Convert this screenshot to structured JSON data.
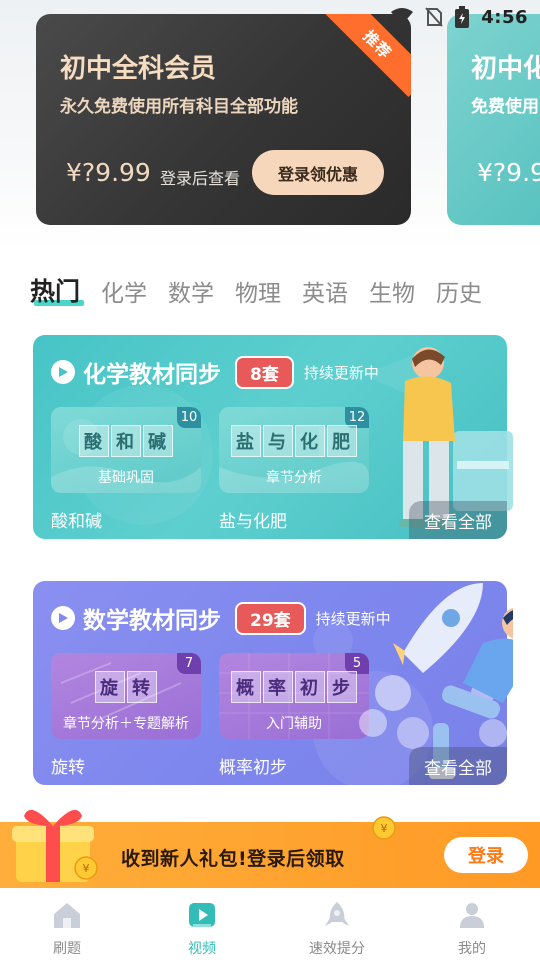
{
  "status_bar": {
    "time": "4:56",
    "icons": [
      "wifi-icon",
      "no-sim-icon",
      "battery-icon"
    ]
  },
  "member_cards": [
    {
      "title": "初中全科会员",
      "subtitle": "永久免费使用所有科目全部功能",
      "price": "¥?9.99",
      "price_note": "登录后查看",
      "button": "登录领优惠",
      "ribbon": "推荐"
    },
    {
      "title": "初中化",
      "subtitle": "免费使用",
      "price": "¥?9.9"
    }
  ],
  "subject_tabs": [
    "热门",
    "化学",
    "数学",
    "物理",
    "英语",
    "生物",
    "历史"
  ],
  "sections": [
    {
      "title": "化学教材同步",
      "count": "8套",
      "status": "持续更新中",
      "items": [
        {
          "cover_title": [
            "酸",
            "和",
            "碱"
          ],
          "cover_sub": "基础巩固",
          "count": "10",
          "label": "酸和碱"
        },
        {
          "cover_title": [
            "盐",
            "与",
            "化",
            "肥"
          ],
          "cover_sub": "章节分析",
          "count": "12",
          "label": "盐与化肥"
        }
      ],
      "see_all": "查看全部"
    },
    {
      "title": "数学教材同步",
      "count": "29套",
      "status": "持续更新中",
      "items": [
        {
          "cover_title": [
            "旋",
            "转"
          ],
          "cover_sub": "章节分析＋专题解析",
          "count": "7",
          "label": "旋转"
        },
        {
          "cover_title": [
            "概",
            "率",
            "初",
            "步"
          ],
          "cover_sub": "入门辅助",
          "count": "5",
          "label": "概率初步"
        }
      ],
      "see_all": "查看全部"
    }
  ],
  "gift_banner": {
    "text": "收到新人礼包!登录后领取",
    "button": "登录"
  },
  "bottom_nav": [
    {
      "label": "刷题",
      "icon": "home-icon"
    },
    {
      "label": "视频",
      "icon": "video-play-icon",
      "active": true
    },
    {
      "label": "速效提分",
      "icon": "rocket-icon"
    },
    {
      "label": "我的",
      "icon": "user-icon"
    }
  ],
  "colors": {
    "accent": "#34bdb8",
    "chem_bg": "#4fc8c9",
    "math_bg": "#8189ee",
    "badge_red": "#e85a5a",
    "gift_orange": "#ffa531"
  }
}
